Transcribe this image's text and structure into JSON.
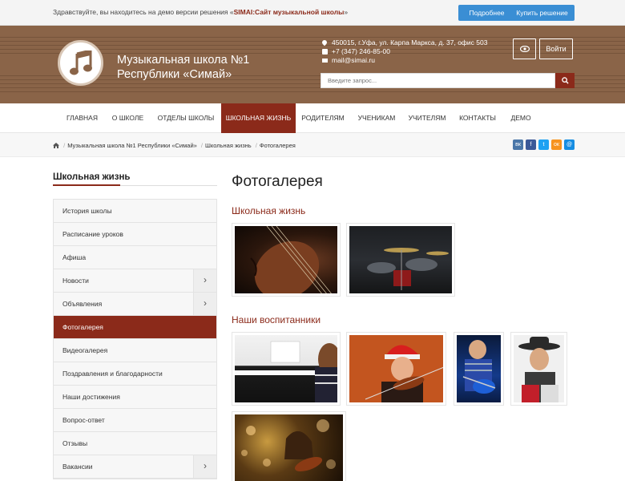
{
  "demo_bar": {
    "text_prefix": "Здравствуйте, вы находитесь на демо версии решения «",
    "text_brand": "SIMAI:Сайт музыкальной школы",
    "text_suffix": "»",
    "details_label": "Подробнее",
    "buy_label": "Купить решение"
  },
  "header": {
    "name_line1": "Музыкальная школа №1",
    "name_line2": "Республики «Симай»",
    "address": "450015, г.Уфа, ул. Карпа Маркса, д. 37, офис 503",
    "phone": "+7 (347) 246-85-00",
    "email": "mail@simai.ru",
    "login_label": "Войти",
    "search_placeholder": "Введите запрос..."
  },
  "nav": {
    "items": [
      "ГЛАВНАЯ",
      "О ШКОЛЕ",
      "ОТДЕЛЫ ШКОЛЫ",
      "ШКОЛЬНАЯ ЖИЗНЬ",
      "РОДИТЕЛЯМ",
      "УЧЕНИКАМ",
      "УЧИТЕЛЯМ",
      "КОНТАКТЫ",
      "ДЕМО"
    ],
    "active_index": 3
  },
  "breadcrumb": [
    "Музыкальная школа №1 Республики «Симай»",
    "Школьная жизнь",
    "Фотогалерея"
  ],
  "social": [
    {
      "label": "вк",
      "color": "#4a76a8"
    },
    {
      "label": "f",
      "color": "#3b5998"
    },
    {
      "label": "t",
      "color": "#1da1f2"
    },
    {
      "label": "ок",
      "color": "#f7931e"
    },
    {
      "label": "@",
      "color": "#168de2"
    }
  ],
  "sidebar": {
    "title": "Школьная жизнь",
    "items": [
      {
        "label": "История школы",
        "has_children": false
      },
      {
        "label": "Расписание уроков",
        "has_children": false
      },
      {
        "label": "Афиша",
        "has_children": false
      },
      {
        "label": "Новости",
        "has_children": true
      },
      {
        "label": "Объявления",
        "has_children": true
      },
      {
        "label": "Фотогалерея",
        "has_children": false,
        "active": true
      },
      {
        "label": "Видеогалерея",
        "has_children": false
      },
      {
        "label": "Поздравления и благодарности",
        "has_children": false
      },
      {
        "label": "Наши достижения",
        "has_children": false
      },
      {
        "label": "Вопрос-ответ",
        "has_children": false
      },
      {
        "label": "Отзывы",
        "has_children": false
      },
      {
        "label": "Вакансии",
        "has_children": true
      }
    ]
  },
  "content": {
    "title": "Фотогалерея",
    "sections": [
      {
        "title": "Школьная жизнь",
        "photos": [
          "cello-photo",
          "drums-photo"
        ]
      },
      {
        "title": "Наши воспитанники",
        "photos": [
          "piano-girl-photo",
          "violin-boy-photo",
          "guitar-boy-photo",
          "accordion-boy-photo",
          "violin-girl-photo"
        ]
      }
    ]
  },
  "colors": {
    "accent": "#8b2a1a",
    "blue": "#3a8ed4",
    "header_bg": "#8a6448"
  }
}
